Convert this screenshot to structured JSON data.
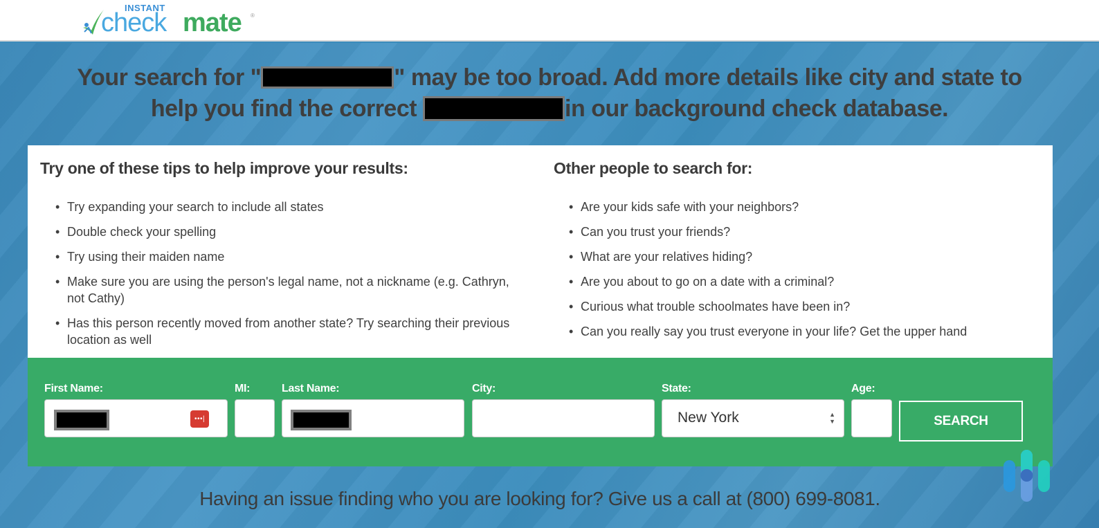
{
  "header": {
    "logo": {
      "prefix": "INSTANT",
      "part1": "check",
      "part2": "mate",
      "registered": "®"
    }
  },
  "headline": {
    "line1_before": "Your search for \"",
    "line1_after": "\" may be too broad. Add more details like city and state to",
    "line2_before": "help you find the correct ",
    "line2_after": "in our background check database."
  },
  "tips": {
    "title": "Try one of these tips to help improve your results:",
    "items": [
      "Try expanding your search to include all states",
      "Double check your spelling",
      "Try using their maiden name",
      "Make sure you are using the person's legal name, not a nickname (e.g. Cathryn, not Cathy)",
      "Has this person recently moved from another state? Try searching their previous location as well"
    ]
  },
  "others": {
    "title": "Other people to search for:",
    "items": [
      "Are your kids safe with your neighbors?",
      "Can you trust your friends?",
      "What are your relatives hiding?",
      "Are you about to go on a date with a criminal?",
      "Curious what trouble schoolmates have been in?",
      "Can you really say you trust everyone in your life? Get the upper hand"
    ]
  },
  "form": {
    "first_name_label": "First Name:",
    "mi_label": "MI:",
    "last_name_label": "Last Name:",
    "city_label": "City:",
    "state_label": "State:",
    "state_value": "New York",
    "age_label": "Age:",
    "search_label": "SEARCH",
    "password_manager_icon": "•••|"
  },
  "footer": {
    "text": "Having an issue finding who you are looking for? Give us a call at (800) 699-8081."
  },
  "colors": {
    "brand_blue": "#49a8e0",
    "brand_green": "#3eaa5e",
    "form_green": "#38ab67",
    "hero_blue": "#3b8bbb",
    "text_dark": "#3e3e3e"
  }
}
